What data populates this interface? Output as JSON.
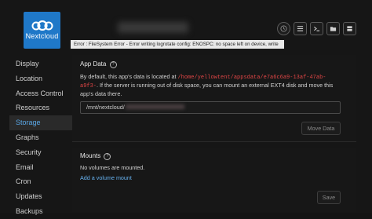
{
  "header": {
    "logo_text": "Nextcloud",
    "error_message": "Error : FileSystem Error - Error writing logrotate config: ENOSPC: no space left on device, write",
    "toolbar_icons": [
      "clock-icon",
      "list-icon",
      "terminal-icon",
      "folder-icon",
      "server-icon"
    ]
  },
  "sidebar": {
    "items": [
      {
        "label": "Display"
      },
      {
        "label": "Location"
      },
      {
        "label": "Access Control"
      },
      {
        "label": "Resources"
      },
      {
        "label": "Storage"
      },
      {
        "label": "Graphs"
      },
      {
        "label": "Security"
      },
      {
        "label": "Email"
      },
      {
        "label": "Cron"
      },
      {
        "label": "Updates"
      },
      {
        "label": "Backups"
      }
    ],
    "active": "Storage"
  },
  "app_data": {
    "title": "App Data",
    "help": "?",
    "desc_prefix": "By default, this app's data is located at ",
    "path_red": "/home/yellowtent/appsdata/e7a6c6a9-13af-47ab-a9f3-",
    "desc_suffix": ". If the server is running out of disk space, you can mount an external EXT4 disk and move this app's data there.",
    "input_value": "/mnt/nextcloud/",
    "move_button": "Move Data"
  },
  "mounts": {
    "title": "Mounts",
    "help": "?",
    "empty_text": "No volumes are mounted.",
    "add_link": "Add a volume mount",
    "save_button": "Save"
  },
  "colors": {
    "accent": "#5aa7e6",
    "error_path": "#e04646",
    "logo_bg": "#1f78c8"
  }
}
